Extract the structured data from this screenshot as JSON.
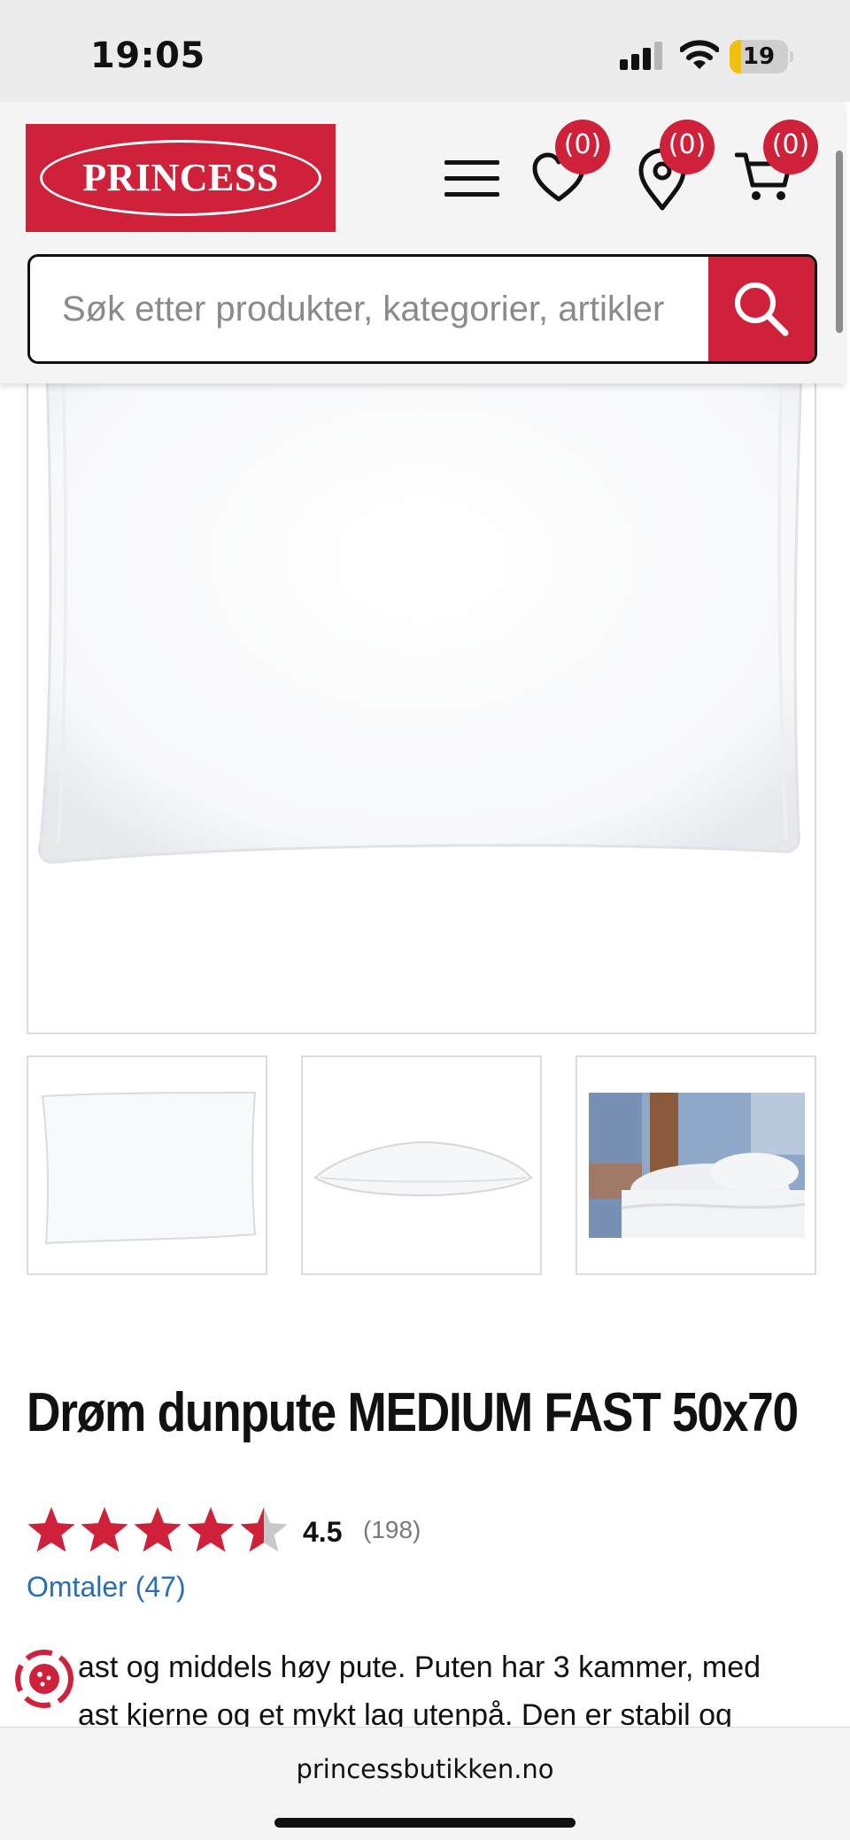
{
  "status_bar": {
    "time": "19:05",
    "battery_level": "19",
    "battery_fraction": 0.19,
    "icons": [
      "signal-icon",
      "wifi-icon",
      "battery-icon"
    ]
  },
  "header": {
    "logo_text": "PRINCESS",
    "wishlist_count": "(0)",
    "stores_count": "(0)",
    "cart_count": "(0)",
    "icons": [
      "menu-icon",
      "heart-icon",
      "location-pin-icon",
      "cart-icon"
    ]
  },
  "search": {
    "placeholder": "Søk etter produkter, kategorier, artikler",
    "icon": "search-icon"
  },
  "product": {
    "title": "Drøm dunpute MEDIUM FAST 50x70",
    "rating_value": "4.5",
    "rating": 4.5,
    "rating_max": 5,
    "rating_count": "(198)",
    "reviews_link": "Omtaler (47)",
    "description_line_1": "ast og middels høy pute. Puten har 3 kammer, med",
    "description_line_2": "ast kjerne og et mykt lag utenpå. Den er stabil og"
  },
  "browser": {
    "url": "princessbutikken.no"
  },
  "colors": {
    "brand_red": "#d0213b",
    "link_blue": "#2a6db5",
    "star_red": "#d0213b",
    "star_empty": "#c8c8c8"
  }
}
